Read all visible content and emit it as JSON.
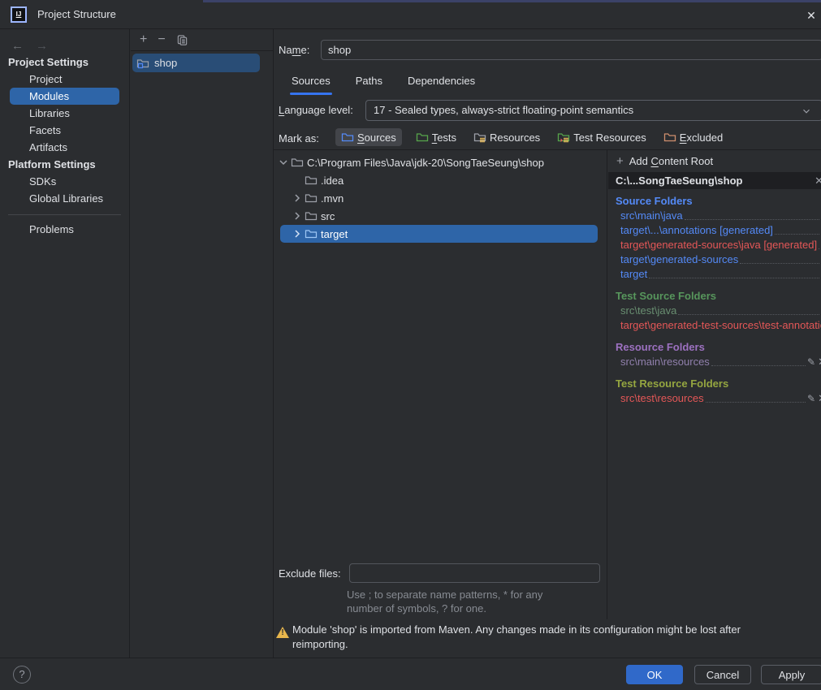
{
  "title_bar": {
    "title": "Project Structure"
  },
  "icons": {
    "close": "✕",
    "back": "←",
    "forward": "→",
    "add": "+",
    "remove": "−",
    "help": "?",
    "pencil": "✎",
    "remove_x": "✕",
    "warning": "!",
    "plus": "+"
  },
  "colors": {
    "dialog_bg": "#2b2d30",
    "selection_blue": "#2e65a8",
    "accent": "#3574f0",
    "link_blue": "#548af7",
    "error_red": "#e45757",
    "test_green": "#57965c",
    "resource_purple": "#9d71c1",
    "test_resource_olive": "#95a640",
    "warning_yellow": "#e8b64c",
    "ok_button": "#3069c9"
  },
  "nav": {
    "sections": [
      {
        "header": "Project Settings",
        "items": [
          "Project",
          "Modules",
          "Libraries",
          "Facets",
          "Artifacts"
        ],
        "selected": "Modules"
      },
      {
        "header": "Platform Settings",
        "items": [
          "SDKs",
          "Global Libraries"
        ]
      }
    ],
    "footer_item": "Problems"
  },
  "modules_panel": {
    "items": [
      {
        "label": "shop",
        "selected": true
      }
    ]
  },
  "form": {
    "name_label": {
      "pre": "Na",
      "key": "m",
      "post": "e:"
    },
    "name_value": "shop",
    "tabs": [
      {
        "label": "Sources",
        "active": true
      },
      {
        "label": "Paths",
        "active": false
      },
      {
        "label": "Dependencies",
        "active": false
      }
    ],
    "language_level_label": {
      "pre": "",
      "key": "L",
      "post": "anguage level:"
    },
    "language_level_value": "17 - Sealed types, always-strict floating-point semantics",
    "mark_as_label": "Mark as:",
    "mark_chips": [
      {
        "pre": "",
        "key": "S",
        "post": "ources",
        "selected": true
      },
      {
        "pre": "",
        "key": "T",
        "post": "ests",
        "selected": false
      },
      {
        "pre": "Resources",
        "key": "",
        "post": "",
        "selected": false
      },
      {
        "pre": "Test Resources",
        "key": "",
        "post": "",
        "selected": false
      },
      {
        "pre": "",
        "key": "E",
        "post": "xcluded",
        "selected": false
      }
    ]
  },
  "tree": {
    "items": [
      {
        "label": "C:\\Program Files\\Java\\jdk-20\\SongTaeSeung\\shop",
        "level": 0,
        "chevron": "expanded",
        "selected": false
      },
      {
        "label": ".idea",
        "level": 1,
        "chevron": "none",
        "selected": false
      },
      {
        "label": ".mvn",
        "level": 1,
        "chevron": "collapsed",
        "selected": false
      },
      {
        "label": "src",
        "level": 1,
        "chevron": "collapsed",
        "selected": false
      },
      {
        "label": "target",
        "level": 1,
        "chevron": "collapsed",
        "selected": true
      }
    ]
  },
  "content_roots": {
    "add_label": {
      "pre": "Add ",
      "key": "C",
      "post": "ontent Root"
    },
    "root_path": "C:\\...SongTaeSeung\\shop",
    "sections": [
      {
        "title": "Source Folders",
        "items": [
          {
            "path": "src\\main\\java",
            "state": "source"
          },
          {
            "path": "target\\...\\annotations [generated]",
            "state": "source"
          },
          {
            "path": "target\\generated-sources\\java [generated]",
            "state": "excluded-conflict"
          },
          {
            "path": "target\\generated-sources",
            "state": "source"
          },
          {
            "path": "target",
            "state": "source"
          }
        ]
      },
      {
        "title": "Test Source Folders",
        "items": [
          {
            "path": "src\\test\\java",
            "state": "test"
          },
          {
            "path": "target\\generated-test-sources\\test-annotations",
            "state": "excluded-conflict"
          }
        ]
      },
      {
        "title": "Resource Folders",
        "items": [
          {
            "path": "src\\main\\resources",
            "state": "resource"
          }
        ]
      },
      {
        "title": "Test Resource Folders",
        "items": [
          {
            "path": "src\\test\\resources",
            "state": "excluded-conflict"
          }
        ]
      }
    ]
  },
  "exclude": {
    "label": "Exclude files:",
    "value": "",
    "hint_lines": [
      "Use ; to separate name patterns, * for any",
      "number of symbols, ? for one."
    ]
  },
  "warning": {
    "lines": [
      "Module 'shop' is imported from Maven. Any changes made in its configuration might be lost after",
      "reimporting."
    ]
  },
  "footer": {
    "help": "?",
    "ok": "OK",
    "cancel": "Cancel",
    "apply": "Apply"
  }
}
